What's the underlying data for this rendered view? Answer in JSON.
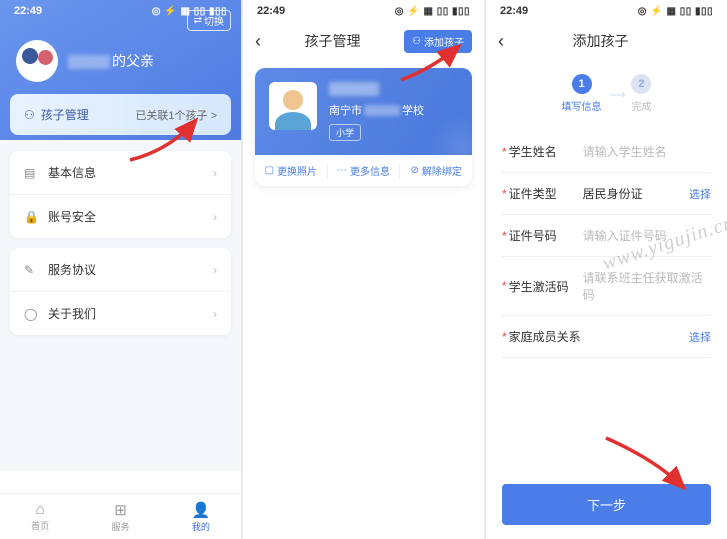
{
  "statusbar": {
    "time": "22:49",
    "icons": "◎ ⚡ ▦ ▯▯ ▮▯▯"
  },
  "s1": {
    "switch": "切换",
    "profile_name_suffix": "的父亲",
    "child_mgmt": {
      "label": "孩子管理",
      "status": "已关联1个孩子 >"
    },
    "menu1": [
      {
        "icon": "file",
        "label": "基本信息"
      },
      {
        "icon": "lock",
        "label": "账号安全"
      }
    ],
    "menu2": [
      {
        "icon": "doc",
        "label": "服务协议"
      },
      {
        "icon": "help",
        "label": "关于我们"
      }
    ],
    "tabs": [
      {
        "icon": "home",
        "label": "首页"
      },
      {
        "icon": "grid",
        "label": "服务"
      },
      {
        "icon": "user",
        "label": "我的"
      }
    ]
  },
  "s2": {
    "title": "孩子管理",
    "add_btn": "添加孩子",
    "school_prefix": "南宁市",
    "school_suffix": "学校",
    "grade": "小学",
    "actions": [
      "更换照片",
      "更多信息",
      "解除绑定"
    ]
  },
  "s3": {
    "title": "添加孩子",
    "steps": [
      "填写信息",
      "完成"
    ],
    "form": [
      {
        "label": "学生姓名",
        "placeholder": "请输入学生姓名",
        "type": "input"
      },
      {
        "label": "证件类型",
        "value": "居民身份证",
        "type": "select",
        "action": "选择"
      },
      {
        "label": "证件号码",
        "placeholder": "请输入证件号码",
        "type": "input"
      },
      {
        "label": "学生激活码",
        "placeholder": "请联系班主任获取激活码",
        "type": "input"
      },
      {
        "label": "家庭成员关系",
        "placeholder": "",
        "type": "select",
        "action": "选择"
      }
    ],
    "next": "下一步"
  },
  "watermark": "www.yigujin.cn"
}
